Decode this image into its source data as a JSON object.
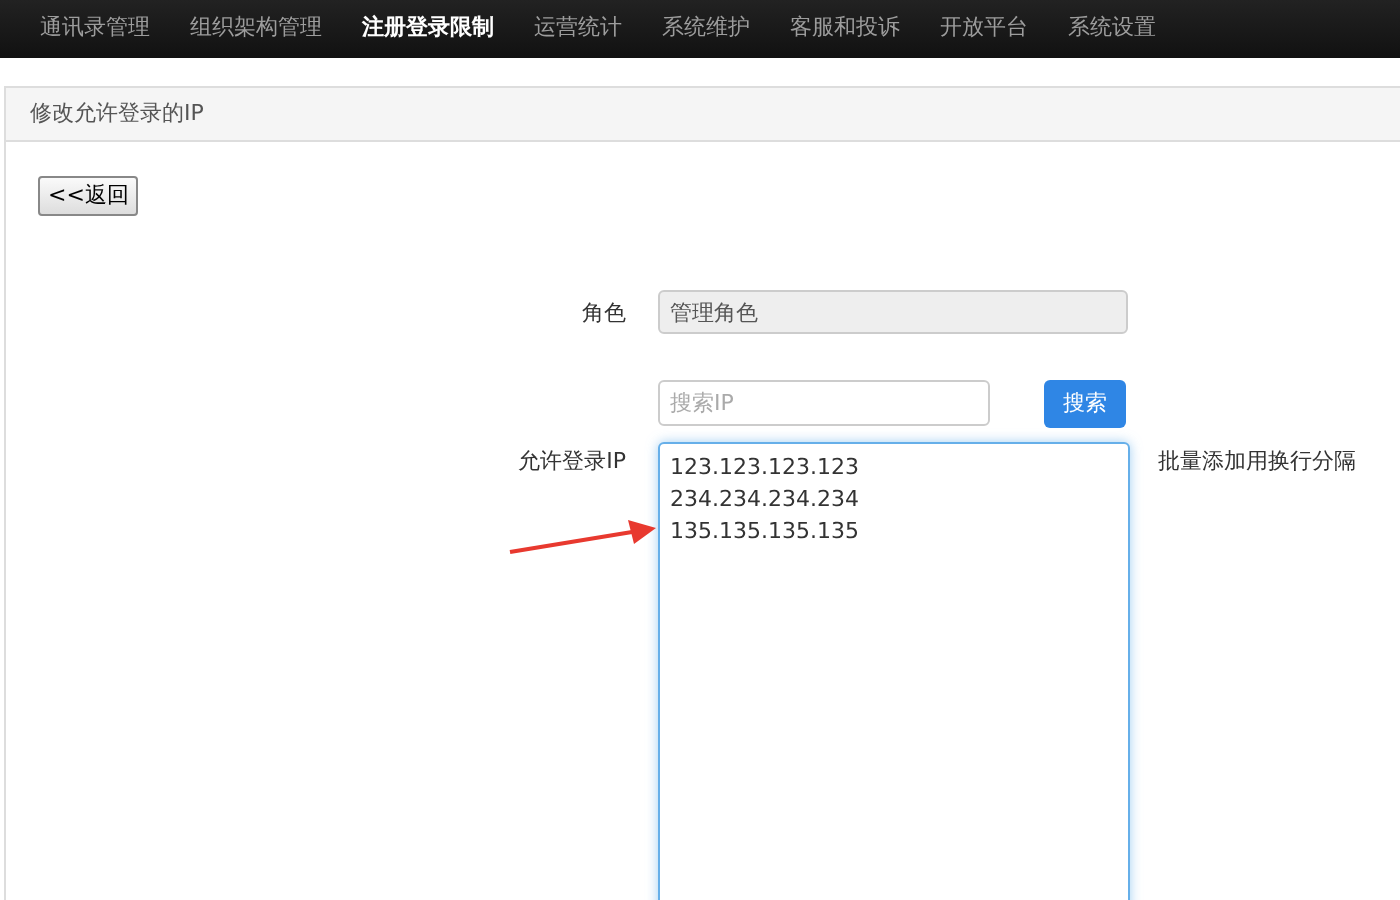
{
  "nav": {
    "items": [
      {
        "label": "通讯录管理",
        "selected": false
      },
      {
        "label": "组织架构管理",
        "selected": false
      },
      {
        "label": "注册登录限制",
        "selected": true
      },
      {
        "label": "运营统计",
        "selected": false
      },
      {
        "label": "系统维护",
        "selected": false
      },
      {
        "label": "客服和投诉",
        "selected": false
      },
      {
        "label": "开放平台",
        "selected": false
      },
      {
        "label": "系统设置",
        "selected": false
      }
    ]
  },
  "panel": {
    "title": "修改允许登录的IP",
    "back_button": "<<返回"
  },
  "form": {
    "role": {
      "label": "角色",
      "value": "管理角色",
      "disabled": true
    },
    "search": {
      "placeholder": "搜索IP",
      "button": "搜索"
    },
    "ips": {
      "label": "允许登录IP",
      "lines": [
        "123.123.123.123",
        "234.234.234.234",
        "135.135.135.135"
      ],
      "hint": "批量添加用换行分隔"
    }
  }
}
